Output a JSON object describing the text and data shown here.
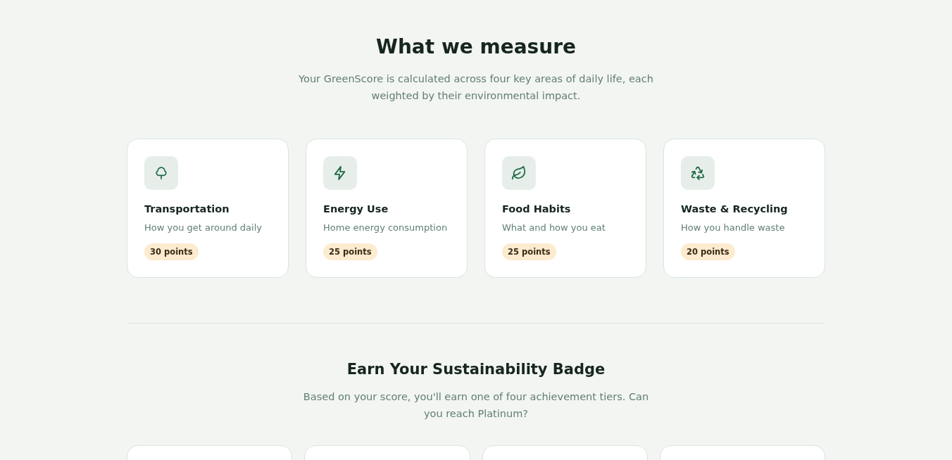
{
  "measure": {
    "title": "What we measure",
    "subtitle": "Your GreenScore is calculated across four key areas of daily life, each weighted by their environmental impact.",
    "categories": [
      {
        "kind": "tree",
        "name": "Transportation",
        "description": "How you get around daily",
        "points": "30 points"
      },
      {
        "kind": "bolt",
        "name": "Energy Use",
        "description": "Home energy consumption",
        "points": "25 points"
      },
      {
        "kind": "leaf",
        "name": "Food Habits",
        "description": "What and how you eat",
        "points": "25 points"
      },
      {
        "kind": "recycle",
        "name": "Waste & Recycling",
        "description": "How you handle waste",
        "points": "20 points"
      }
    ]
  },
  "badge": {
    "title": "Earn Your Sustainability Badge",
    "subtitle": "Based on your score, you'll earn one of four achievement tiers. Can you reach Platinum?"
  }
}
